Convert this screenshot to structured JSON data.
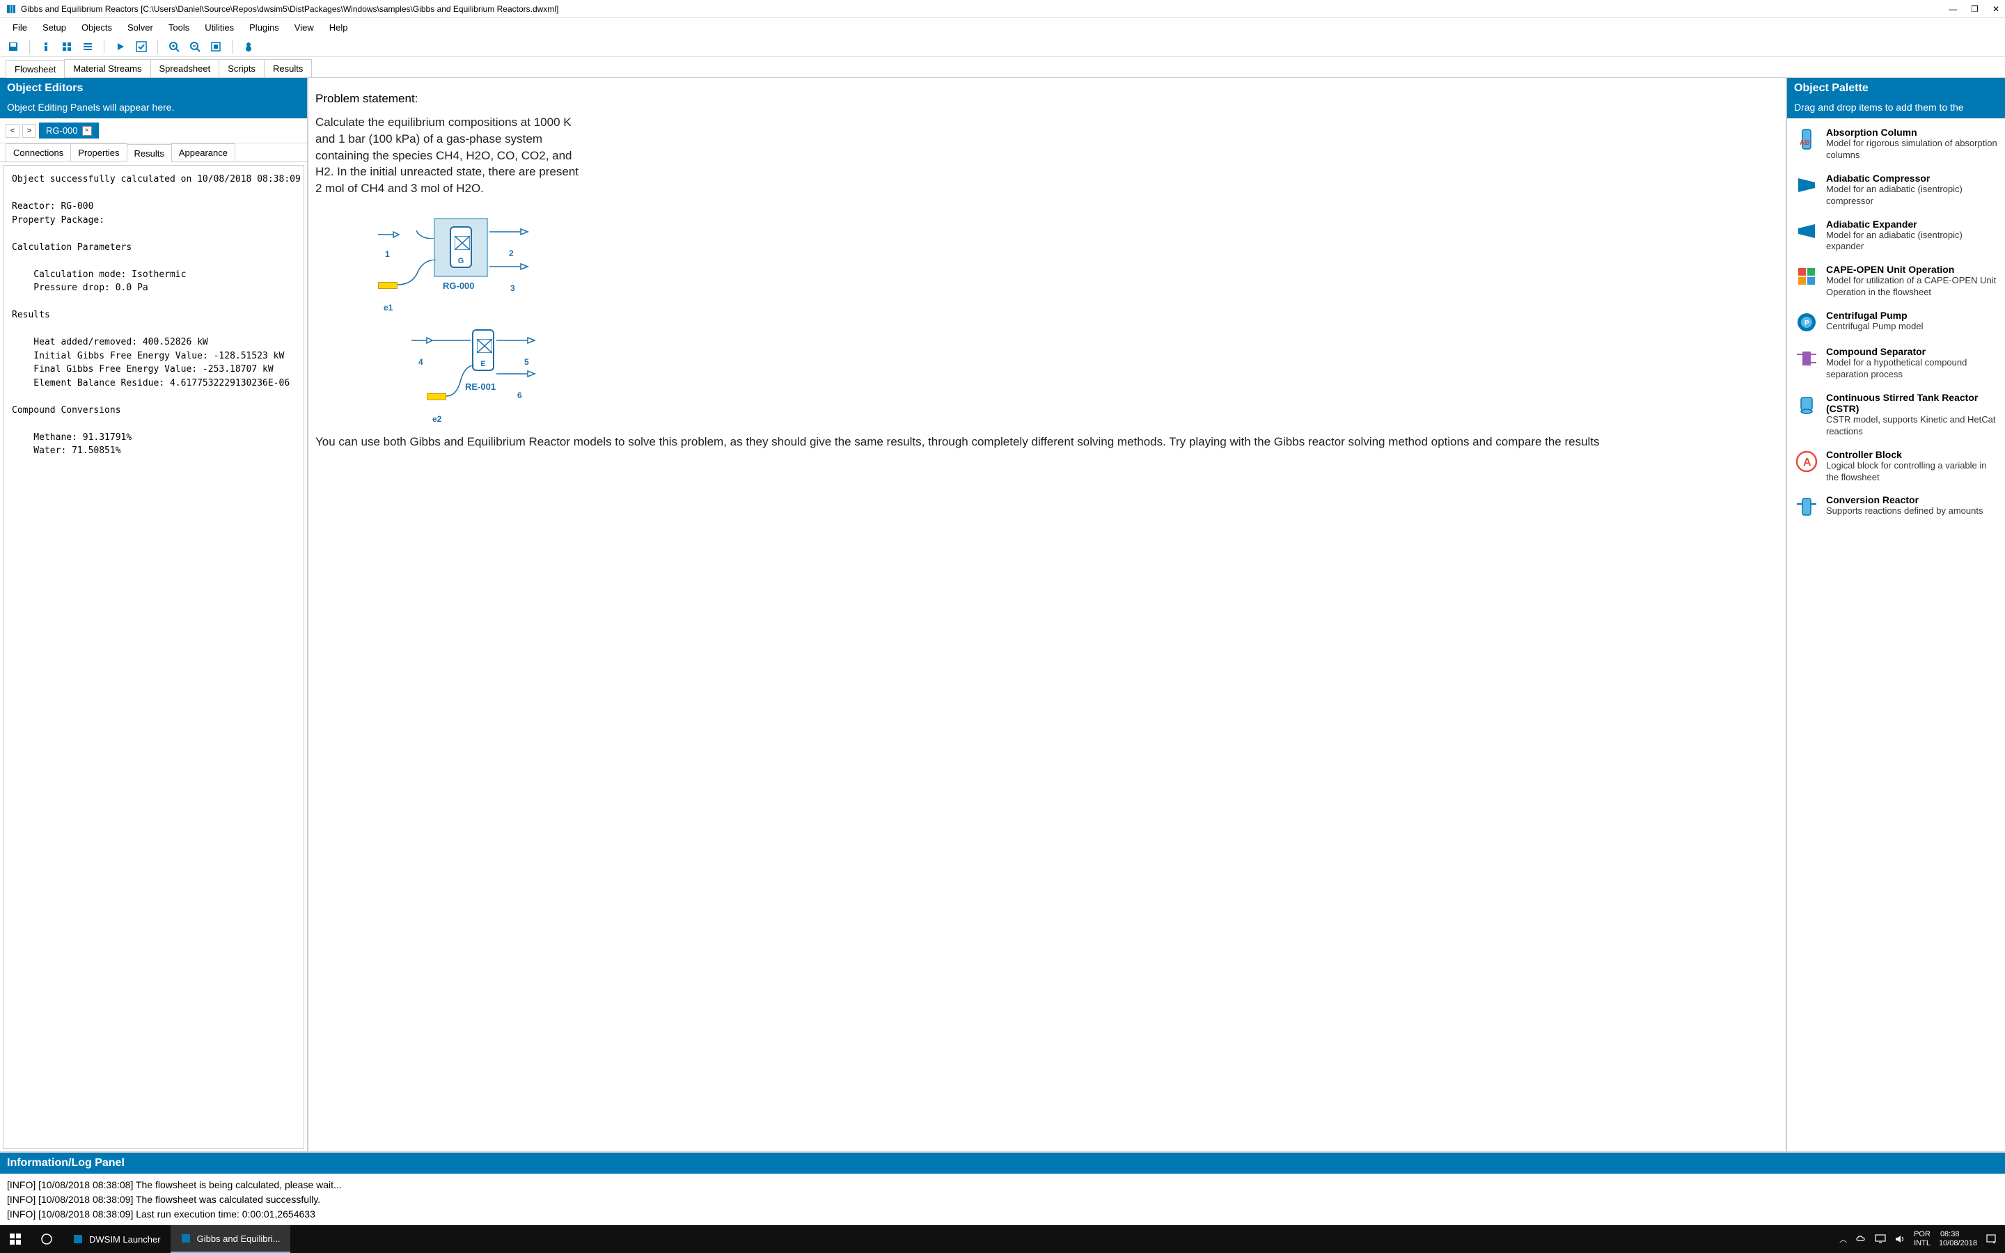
{
  "window": {
    "title": "Gibbs and Equilibrium Reactors [C:\\Users\\Daniel\\Source\\Repos\\dwsim5\\DistPackages\\Windows\\samples\\Gibbs and Equilibrium Reactors.dwxml]"
  },
  "menu": {
    "items": [
      "File",
      "Setup",
      "Objects",
      "Solver",
      "Tools",
      "Utilities",
      "Plugins",
      "View",
      "Help"
    ]
  },
  "doctabs": {
    "items": [
      "Flowsheet",
      "Material Streams",
      "Spreadsheet",
      "Scripts",
      "Results"
    ],
    "active": 0
  },
  "left": {
    "header": "Object Editors",
    "subheader": "Object Editing Panels will appear here.",
    "breadcrumb_tab": "RG-000",
    "subtabs": [
      "Connections",
      "Properties",
      "Results",
      "Appearance"
    ],
    "subtab_active": 2,
    "results_text": "Object successfully calculated on 10/08/2018 08:38:09\n\nReactor: RG-000\nProperty Package:\n\nCalculation Parameters\n\n    Calculation mode: Isothermic\n    Pressure drop: 0.0 Pa\n\nResults\n\n    Heat added/removed: 400.52826 kW\n    Initial Gibbs Free Energy Value: -128.51523 kW\n    Final Gibbs Free Energy Value: -253.18707 kW\n    Element Balance Residue: 4.6177532229130236E-06\n\nCompound Conversions\n\n    Methane: 91.31791%\n    Water: 71.50851%"
  },
  "canvas": {
    "title": "Problem statement:",
    "body": "Calculate the equilibrium compositions at 1000 K and 1 bar (100 kPa) of a gas-phase system containing the species CH4, H2O, CO, CO2, and H2. In the initial unreacted state, there are present 2 mol of CH4 and 3 mol of H2O.",
    "labels": {
      "s1": "1",
      "s2": "2",
      "s3": "3",
      "s4": "4",
      "s5": "5",
      "s6": "6",
      "e1": "e1",
      "e2": "e2",
      "rg": "RG-000",
      "re": "RE-001",
      "G": "G",
      "E": "E"
    },
    "footer": "You can use both Gibbs and Equilibrium Reactor models to solve this problem, as they should give the same results, through completely different solving methods. Try playing with the Gibbs reactor solving method options and compare the results"
  },
  "right": {
    "header": "Object Palette",
    "subheader": "Drag and drop items to add them to the",
    "items": [
      {
        "title": "Absorption Column",
        "desc": "Model for rigorous simulation of absorption columns",
        "icon": "absorption"
      },
      {
        "title": "Adiabatic Compressor",
        "desc": "Model for an adiabatic (isentropic) compressor",
        "icon": "compressor"
      },
      {
        "title": "Adiabatic Expander",
        "desc": "Model for an adiabatic (isentropic) expander",
        "icon": "expander"
      },
      {
        "title": "CAPE-OPEN Unit Operation",
        "desc": "Model for utilization of a CAPE-OPEN Unit Operation in the flowsheet",
        "icon": "capeopen"
      },
      {
        "title": "Centrifugal Pump",
        "desc": "Centrifugal Pump model",
        "icon": "pump"
      },
      {
        "title": "Compound Separator",
        "desc": "Model for a hypothetical compound separation process",
        "icon": "separator"
      },
      {
        "title": "Continuous Stirred Tank Reactor (CSTR)",
        "desc": "CSTR model, supports Kinetic and HetCat reactions",
        "icon": "cstr"
      },
      {
        "title": "Controller Block",
        "desc": "Logical block for controlling a variable in the flowsheet",
        "icon": "controller"
      },
      {
        "title": "Conversion Reactor",
        "desc": "Supports reactions defined by amounts",
        "icon": "conversion"
      }
    ]
  },
  "log": {
    "header": "Information/Log Panel",
    "lines": [
      "[INFO] [10/08/2018 08:38:08] The flowsheet is being calculated, please wait...",
      "[INFO] [10/08/2018 08:38:09] The flowsheet was calculated successfully.",
      "[INFO] [10/08/2018 08:38:09] Last run execution time: 0:00:01,2654633"
    ]
  },
  "taskbar": {
    "app1": "DWSIM Launcher",
    "app2": "Gibbs and Equilibri...",
    "lang": "POR",
    "kbd": "INTL",
    "time": "08:38",
    "date": "10/08/2018"
  }
}
